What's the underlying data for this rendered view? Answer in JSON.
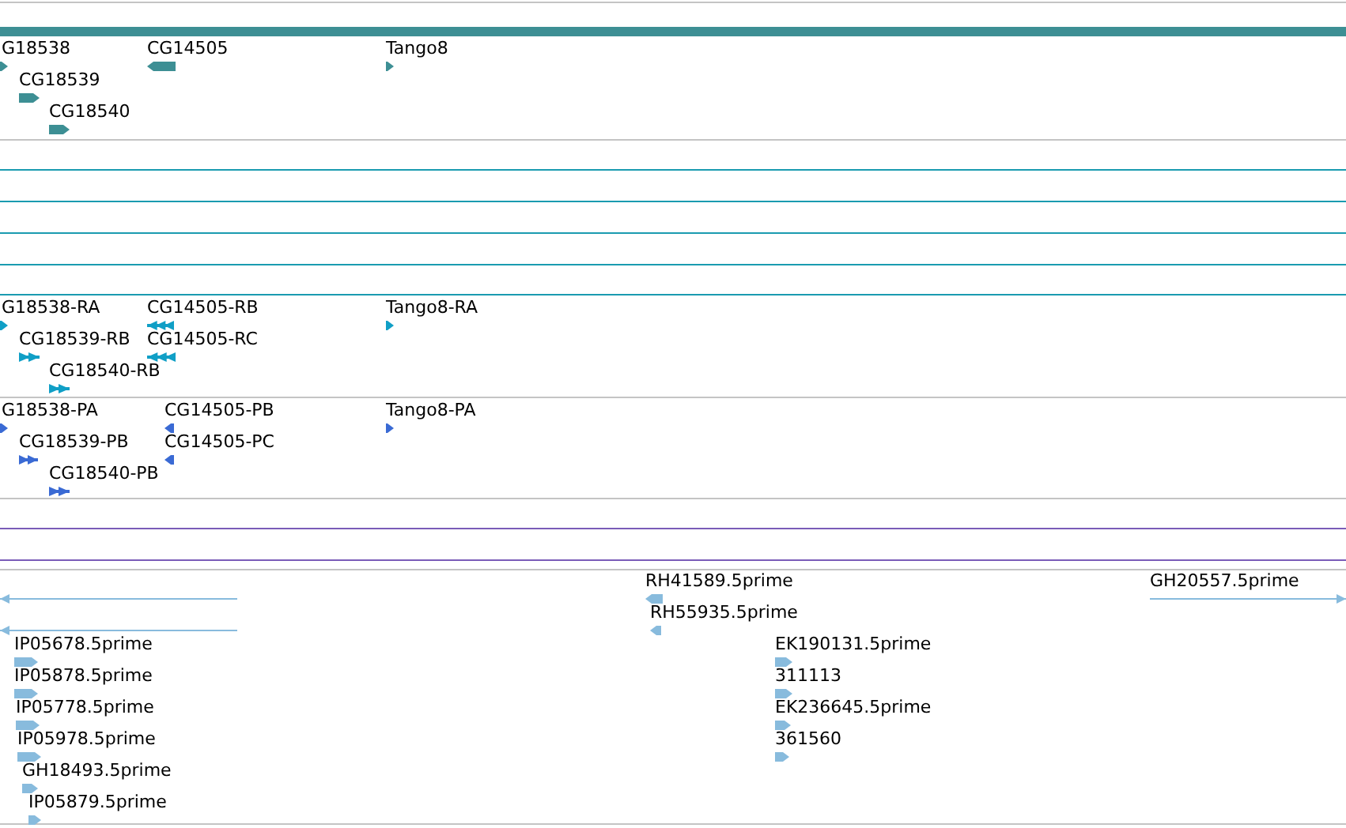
{
  "tracks": [
    {
      "kind": "gene",
      "features": [
        {
          "label": "G18538",
          "reverse": false
        },
        {
          "label": "CG14505",
          "reverse": true
        },
        {
          "label": "Tango8",
          "reverse": false
        },
        {
          "label": "CG18539",
          "reverse": false
        },
        {
          "label": "CG18540",
          "reverse": false
        }
      ]
    },
    {
      "kind": "empty"
    },
    {
      "kind": "empty"
    },
    {
      "kind": "empty"
    },
    {
      "kind": "empty"
    },
    {
      "kind": "empty"
    },
    {
      "kind": "transcript",
      "features": [
        {
          "label": "G18538-RA",
          "reverse": false
        },
        {
          "label": "CG14505-RB",
          "reverse": true
        },
        {
          "label": "Tango8-RA",
          "reverse": false
        },
        {
          "label": "CG18539-RB",
          "reverse": false
        },
        {
          "label": "CG14505-RC",
          "reverse": true
        },
        {
          "label": "CG18540-RB",
          "reverse": false
        }
      ]
    },
    {
      "kind": "protein",
      "features": [
        {
          "label": "G18538-PA",
          "reverse": false
        },
        {
          "label": "CG14505-PB",
          "reverse": true
        },
        {
          "label": "Tango8-PA",
          "reverse": false
        },
        {
          "label": "CG18539-PB",
          "reverse": false
        },
        {
          "label": "CG14505-PC",
          "reverse": true
        },
        {
          "label": "CG18540-PB",
          "reverse": false
        }
      ]
    },
    {
      "kind": "empty"
    },
    {
      "kind": "empty"
    },
    {
      "kind": "empty"
    },
    {
      "kind": "est",
      "features": [
        {
          "reverse": true
        },
        {
          "reverse": true
        },
        {
          "label": "RH41589.5prime",
          "reverse": true
        },
        {
          "label": "GH20557.5prime",
          "reverse": false
        },
        {
          "label": "RH55935.5prime",
          "reverse": true
        },
        {
          "label": "IP05678.5prime",
          "reverse": false
        },
        {
          "label": "EK190131.5prime",
          "reverse": false
        },
        {
          "label": "IP05878.5prime",
          "reverse": false
        },
        {
          "label": "311113",
          "reverse": false
        },
        {
          "label": "IP05778.5prime",
          "reverse": false
        },
        {
          "label": "EK236645.5prime",
          "reverse": false
        },
        {
          "label": "IP05978.5prime",
          "reverse": false
        },
        {
          "label": "361560",
          "reverse": false
        },
        {
          "label": "GH18493.5prime",
          "reverse": false
        },
        {
          "label": "IP05879.5prime",
          "reverse": false
        }
      ]
    }
  ]
}
